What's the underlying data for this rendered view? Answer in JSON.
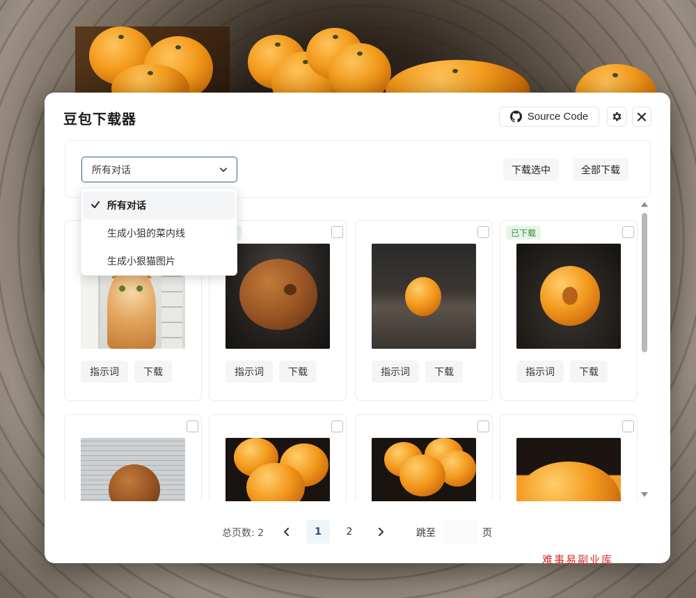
{
  "dialog": {
    "title": "豆包下载器",
    "source_code_label": "Source Code",
    "settings_icon": "gear-icon",
    "close_icon": "close-icon"
  },
  "toolbar": {
    "select_value": "所有对话",
    "download_selected_label": "下载选中",
    "download_all_label": "全部下载"
  },
  "dropdown": {
    "items": [
      {
        "label": "所有对话",
        "selected": true
      },
      {
        "label": "生成小狙的菜内线",
        "selected": false
      },
      {
        "label": "生成小狠猫图片",
        "selected": false
      }
    ]
  },
  "cards": [
    {
      "badge": "",
      "prompt_label": "指示词",
      "download_label": "下载",
      "thumb": "cat-video"
    },
    {
      "badge": "下载",
      "prompt_label": "指示词",
      "download_label": "下载",
      "thumb": "wrinkled-orange"
    },
    {
      "badge": "",
      "prompt_label": "指示词",
      "download_label": "下载",
      "thumb": "orange-on-table"
    },
    {
      "badge": "已下载",
      "prompt_label": "指示词",
      "download_label": "下载",
      "thumb": "rotting-orange"
    },
    {
      "badge": "",
      "thumb": "orange-on-newspaper"
    },
    {
      "badge": "",
      "thumb": "orange-pile"
    },
    {
      "badge": "",
      "thumb": "orange-pile-2"
    },
    {
      "badge": "",
      "thumb": "large-orange"
    }
  ],
  "pagination": {
    "total_label": "总页数: 2",
    "pages": [
      "1",
      "2"
    ],
    "current_page": "1",
    "goto_label": "跳至",
    "goto_value": "",
    "page_suffix": "页"
  },
  "watermark": "难事易副业库",
  "colors": {
    "accent": "#3b5b7c",
    "downloaded_badge_bg": "#e8f6e8",
    "downloaded_badge_text": "#2f8a3b",
    "watermark": "#d42a2a"
  }
}
